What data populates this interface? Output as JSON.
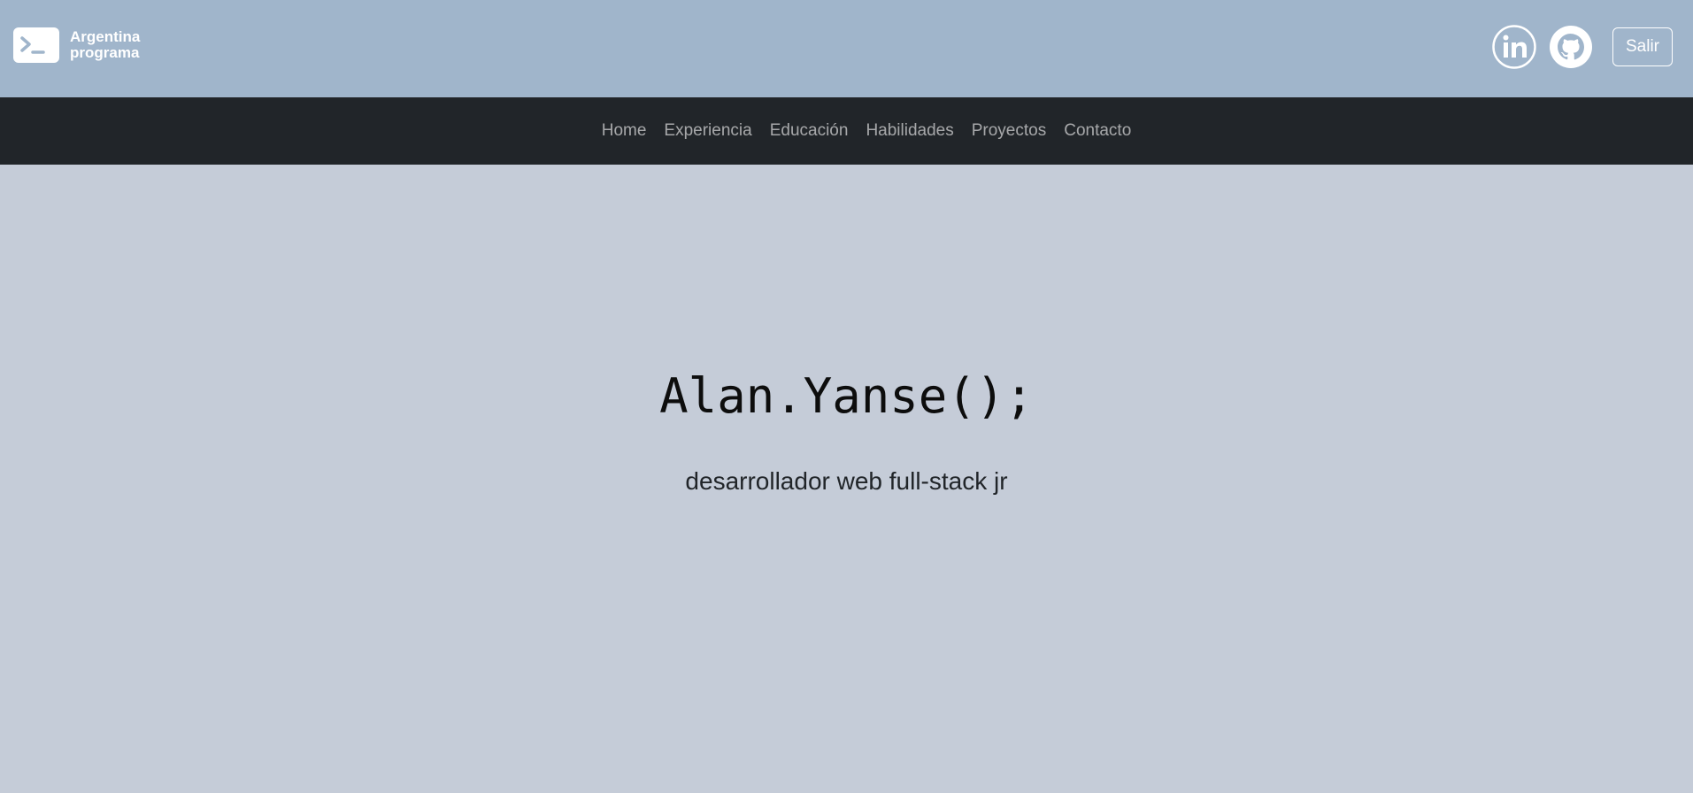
{
  "header": {
    "logo": {
      "line1": "Argentina",
      "line2": "programa"
    },
    "social": {
      "linkedin_icon": "linkedin-icon",
      "github_icon": "github-icon"
    },
    "logout_label": "Salir"
  },
  "nav": {
    "items": [
      {
        "label": "Home"
      },
      {
        "label": "Experiencia"
      },
      {
        "label": "Educación"
      },
      {
        "label": "Habilidades"
      },
      {
        "label": "Proyectos"
      },
      {
        "label": "Contacto"
      }
    ]
  },
  "hero": {
    "title": "Alan.Yanse();",
    "subtitle": "desarrollador web full-stack jr"
  },
  "colors": {
    "topbar": "#a0b5cb",
    "navbar": "#212529",
    "hero_bg": "#c5ccd8"
  }
}
